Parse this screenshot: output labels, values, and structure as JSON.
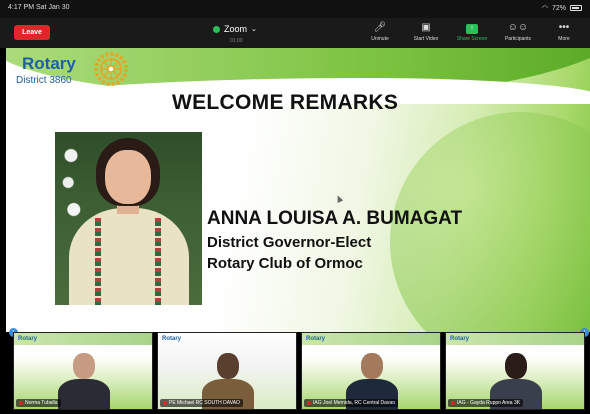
{
  "status_bar": {
    "time": "4:17 PM  Sat Jan 30",
    "battery": "72%",
    "wifi_icon": "wifi-icon",
    "battery_icon": "battery-icon"
  },
  "toolbar": {
    "leave_label": "Leave",
    "app_title": "Zoom",
    "meeting_timer": "01:00",
    "tools": [
      {
        "label": "Unmute",
        "icon": "mic-muted-icon"
      },
      {
        "label": "Start Video",
        "icon": "video-off-icon"
      },
      {
        "label": "Share Screen",
        "icon": "share-screen-icon"
      },
      {
        "label": "Participants",
        "icon": "participants-icon"
      },
      {
        "label": "More",
        "icon": "more-icon"
      }
    ],
    "accent_color": "#2bbf5c",
    "leave_color": "#e0262a"
  },
  "slide": {
    "logo_word": "Rotary",
    "logo_district": "District 3860",
    "title": "WELCOME REMARKS",
    "speaker_name": "ANNA LOUISA A. BUMAGAT",
    "speaker_role": "District Governor-Elect",
    "speaker_club": "Rotary Club of Ormoc",
    "brand_color": "#1f5fa6"
  },
  "gallery": {
    "page_left": "‹",
    "page_right": "›",
    "participants": [
      {
        "name": "Norma Tuballa",
        "slide_logo": "Rotary"
      },
      {
        "name": "PE Michael RC SOUTH DAVAO",
        "slide_logo": "Rotary"
      },
      {
        "name": "IAG Joel Mernida, RC Central Davao",
        "slide_logo": "Rotary"
      },
      {
        "name": "IAG - Gayda Ruppo Area 3K",
        "slide_logo": "Rotary"
      }
    ]
  }
}
